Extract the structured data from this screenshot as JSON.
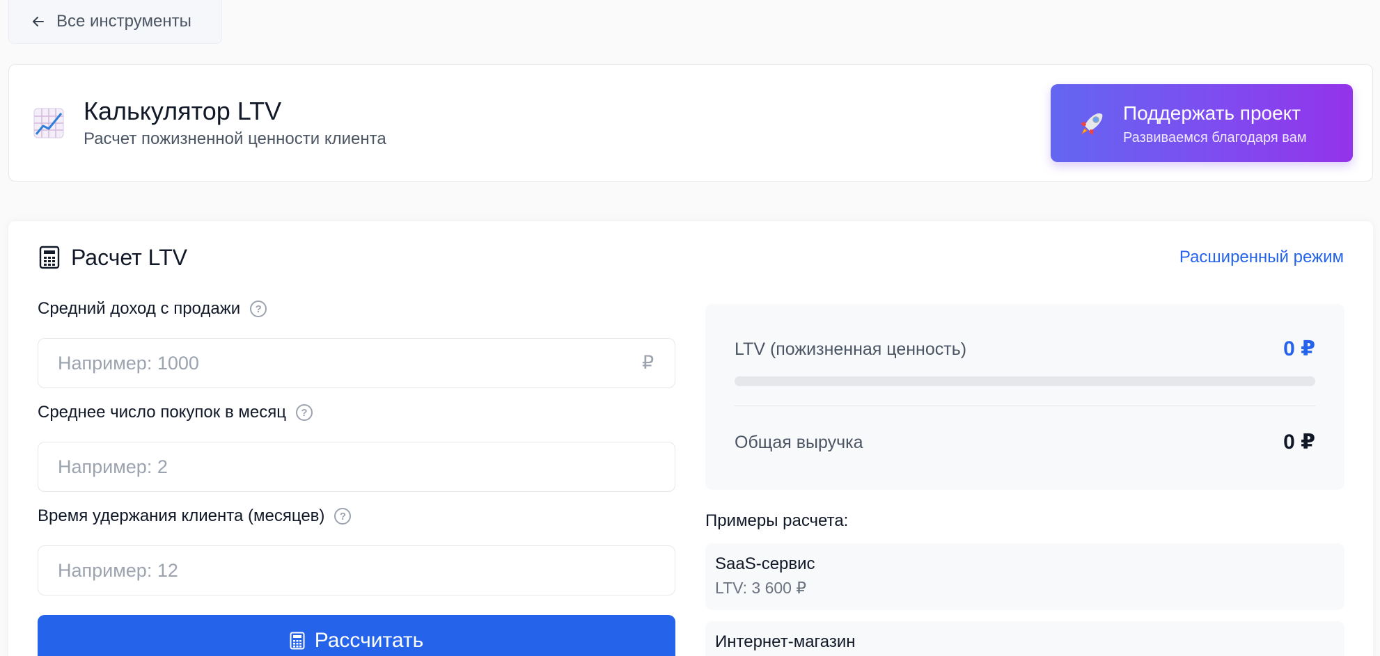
{
  "nav": {
    "back_label": "Все инструменты"
  },
  "header": {
    "title": "Калькулятор LTV",
    "subtitle": "Расчет пожизненной ценности клиента",
    "support": {
      "title": "Поддержать проект",
      "subtitle": "Развиваемся благодаря вам"
    }
  },
  "calculator": {
    "section_title": "Расчет LTV",
    "advanced_link": "Расширенный режим",
    "fields": [
      {
        "label": "Средний доход с продажи",
        "placeholder": "Например: 1000",
        "value": "",
        "suffix": "₽"
      },
      {
        "label": "Среднее число покупок в месяц",
        "placeholder": "Например: 2",
        "value": ""
      },
      {
        "label": "Время удержания клиента (месяцев)",
        "placeholder": "Например: 12",
        "value": ""
      }
    ],
    "calculate_label": "Рассчитать"
  },
  "results": {
    "ltv_label": "LTV (пожизненная ценность)",
    "ltv_value": "0 ₽",
    "ltv_progress": 0,
    "revenue_label": "Общая выручка",
    "revenue_value": "0 ₽"
  },
  "examples": {
    "title": "Примеры расчета:",
    "items": [
      {
        "name": "SaaS-сервис",
        "ltv": "LTV: 3 600 ₽"
      },
      {
        "name": "Интернет-магазин"
      }
    ]
  },
  "colors": {
    "accent": "#2563eb",
    "support_gradient_start": "#6366f1",
    "support_gradient_end": "#9333ea",
    "ltv_value": "#2563eb"
  },
  "icons": {
    "back": "arrow-left-icon",
    "app": "chart-increasing-icon",
    "support": "rocket-icon",
    "calculator": "calculator-icon",
    "help": "question-circle-icon"
  }
}
